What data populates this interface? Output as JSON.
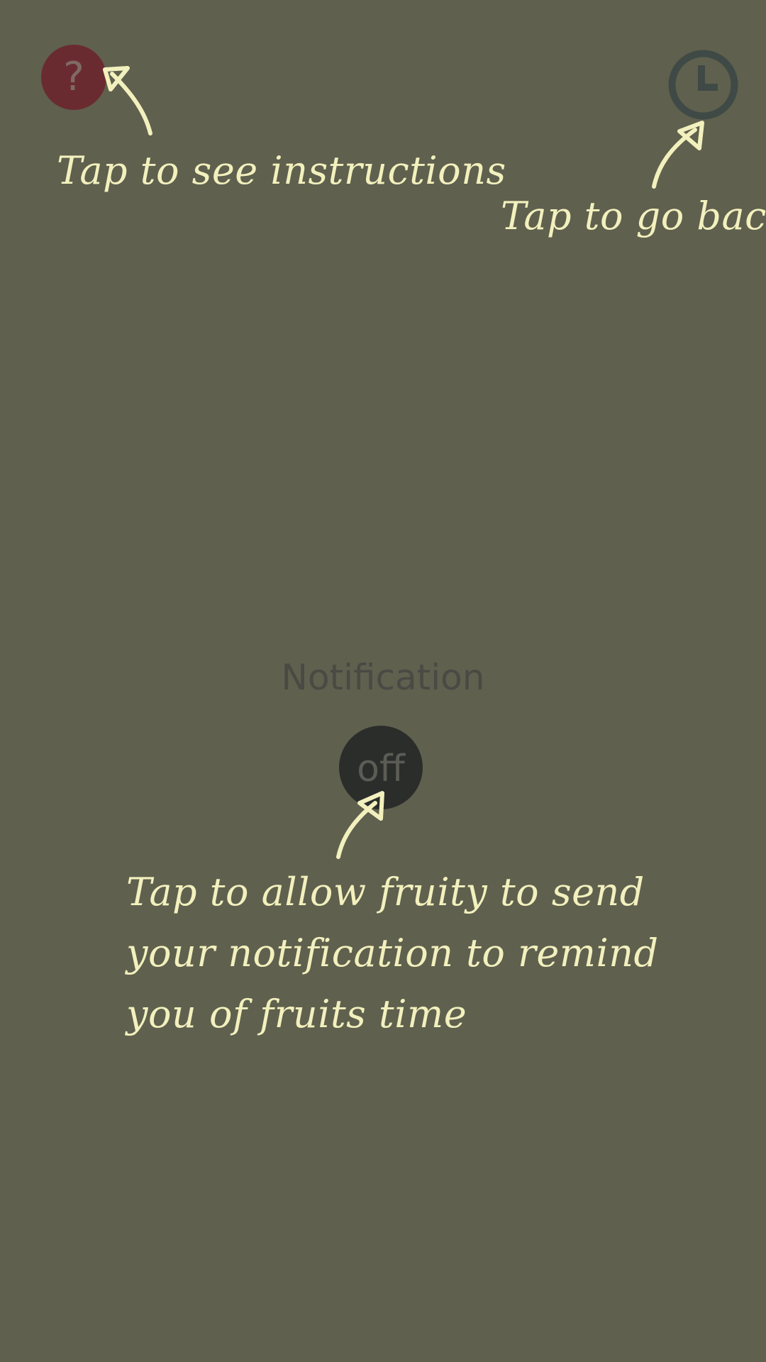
{
  "help_button": {
    "glyph": "?",
    "icon": "question-mark-icon",
    "color": "#6a2b30"
  },
  "back_button": {
    "icon": "clock-icon",
    "color": "#3f4a46"
  },
  "hints": {
    "instructions": "Tap to see instructions",
    "go_back": "Tap to go back",
    "notification": "Tap to allow fruity to send your notification to remind you of fruits time"
  },
  "notification": {
    "title": "Notification",
    "toggle_state": "off"
  },
  "colors": {
    "background": "#5f604e",
    "hint_text": "#f2f0bd",
    "toggle_bg": "#2b2d2b"
  }
}
